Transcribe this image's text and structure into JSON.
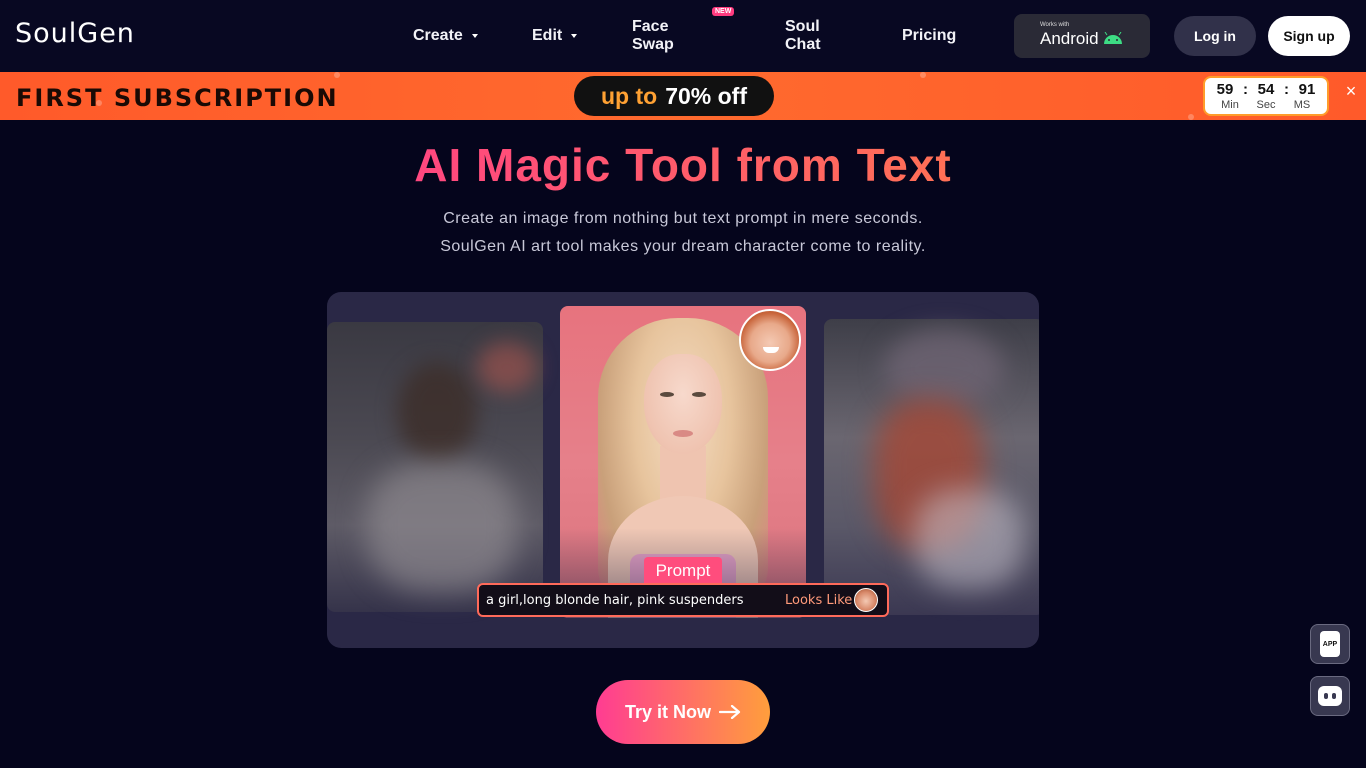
{
  "header": {
    "logo": "SoulGen",
    "nav": {
      "create": "Create",
      "edit": "Edit",
      "face_swap": "Face Swap",
      "face_swap_badge": "NEW",
      "soul_chat": "Soul Chat",
      "pricing": "Pricing"
    },
    "android": {
      "small": "Works with",
      "big": "Android"
    },
    "login": "Log in",
    "signup": "Sign up"
  },
  "promo": {
    "left": "FIRST SUBSCRIPTION",
    "pill_up": "up to",
    "pill_pct": "70% off",
    "timer": {
      "min": "59",
      "sec": "54",
      "ms": "91",
      "min_label": "Min",
      "sec_label": "Sec",
      "ms_label": "MS",
      "sep": ":"
    },
    "close": "×"
  },
  "hero": {
    "title": "AI Magic Tool from Text",
    "sub1": "Create an image from nothing but text prompt in mere seconds.",
    "sub2": "SoulGen AI art tool makes your dream character come to reality."
  },
  "carousel": {
    "prompt_tag": "Prompt",
    "prompt_text": "a girl,long blonde hair, pink suspenders",
    "looks_like": "Looks Like"
  },
  "cta": {
    "label": "Try it Now"
  },
  "floating": {
    "app_label": "APP"
  },
  "colors": {
    "background": "#05051c",
    "header": "#080822",
    "promo": "#ff5a2a",
    "accent_pink": "#ff3c92",
    "accent_orange": "#ff9e3c"
  }
}
